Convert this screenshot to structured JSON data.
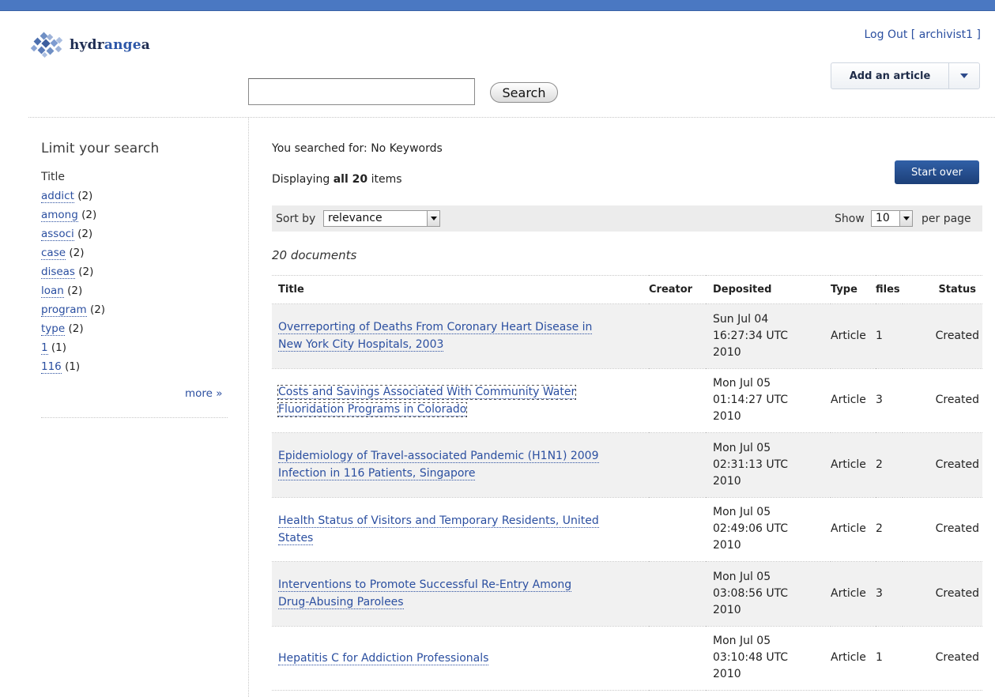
{
  "header": {
    "logo_text_main": "hydr",
    "logo_text_accent": "ange",
    "logo_text_tail": "a",
    "logout_label": "Log Out",
    "user_prefix": "[",
    "username": "archivist1",
    "user_suffix": "]",
    "add_article_label": "Add an article",
    "search_value": "",
    "search_button_label": "Search",
    "colors": {
      "top_bar": "#4a78c2",
      "link": "#2b4fa0",
      "primary_button": "#1c3f78"
    }
  },
  "sidebar": {
    "title": "Limit your search",
    "facet_title": "Title",
    "facets": [
      {
        "label": "addict",
        "count": "(2)"
      },
      {
        "label": "among",
        "count": "(2)"
      },
      {
        "label": "associ",
        "count": "(2)"
      },
      {
        "label": "case",
        "count": "(2)"
      },
      {
        "label": "diseas",
        "count": "(2)"
      },
      {
        "label": "loan",
        "count": "(2)"
      },
      {
        "label": "program",
        "count": "(2)"
      },
      {
        "label": "type",
        "count": "(2)"
      },
      {
        "label": "1",
        "count": "(1)"
      },
      {
        "label": "116",
        "count": "(1)"
      }
    ],
    "more_label": "more »"
  },
  "main": {
    "searched_label": "You searched for: No Keywords",
    "displaying_prefix": "Displaying",
    "displaying_bold": "all 20",
    "displaying_suffix": "items",
    "start_over_label": "Start over",
    "sort_label": "Sort by",
    "sort_value": "relevance",
    "show_label": "Show",
    "per_page_value": "10",
    "per_page_label": "per page",
    "doc_count": "20 documents",
    "columns": [
      "Title",
      "Creator",
      "Deposited",
      "Type",
      "files",
      "Status"
    ],
    "rows": [
      {
        "title_line1": "Overreporting of Deaths From Coronary Heart Disease in",
        "title_line2": "New York City Hospitals, 2003",
        "creator": "",
        "dep1": "Sun Jul 04",
        "dep2": "16:27:34 UTC",
        "dep3": "2010",
        "type": "Article",
        "files": "1",
        "status": "Created"
      },
      {
        "title_line1": "Costs and Savings Associated With Community Water",
        "title_line2": "Fluoridation Programs in Colorado",
        "creator": "",
        "dep1": "Mon Jul 05",
        "dep2": "01:14:27 UTC",
        "dep3": "2010",
        "type": "Article",
        "files": "3",
        "status": "Created"
      },
      {
        "title_line1": "Epidemiology of Travel-associated Pandemic (H1N1) 2009",
        "title_line2": "Infection in 116 Patients, Singapore",
        "creator": "",
        "dep1": "Mon Jul 05",
        "dep2": "02:31:13 UTC",
        "dep3": "2010",
        "type": "Article",
        "files": "2",
        "status": "Created"
      },
      {
        "title_line1": "Health Status of Visitors and Temporary Residents, United",
        "title_line2": "States",
        "creator": "",
        "dep1": "Mon Jul 05",
        "dep2": "02:49:06 UTC",
        "dep3": "2010",
        "type": "Article",
        "files": "2",
        "status": "Created"
      },
      {
        "title_line1": "Interventions to Promote Successful Re-Entry Among",
        "title_line2": "Drug-Abusing Parolees",
        "creator": "",
        "dep1": "Mon Jul 05",
        "dep2": "03:08:56 UTC",
        "dep3": "2010",
        "type": "Article",
        "files": "3",
        "status": "Created"
      },
      {
        "title_line1": "Hepatitis C for Addiction Professionals",
        "title_line2": "",
        "creator": "",
        "dep1": "Mon Jul 05",
        "dep2": "03:10:48 UTC",
        "dep3": "2010",
        "type": "Article",
        "files": "1",
        "status": "Created"
      }
    ]
  }
}
